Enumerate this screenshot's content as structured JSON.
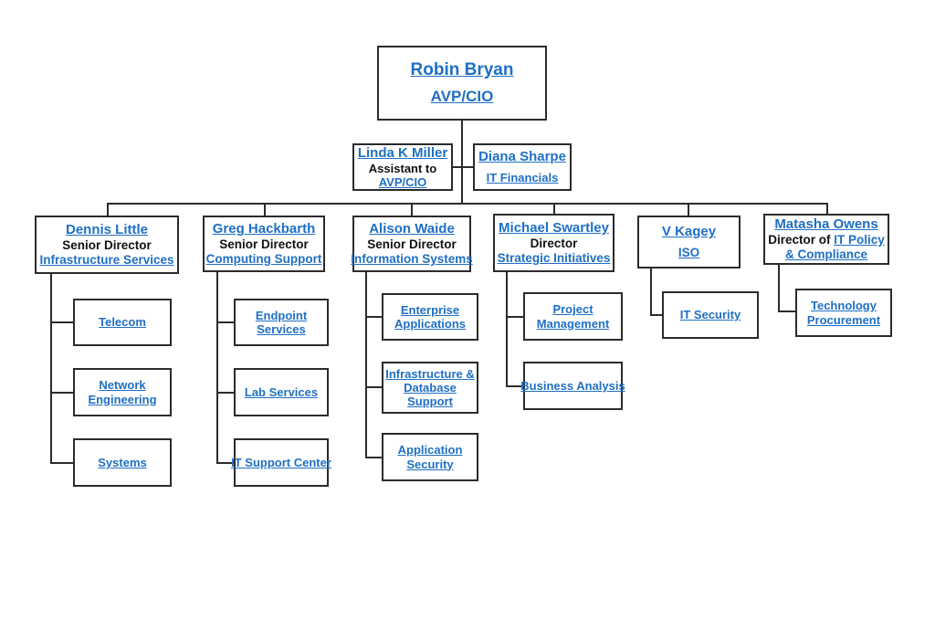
{
  "document": {
    "type": "organizational-chart",
    "background_color": "#ffffff",
    "link_color": "#1f6fc4",
    "text_color": "#111111",
    "border_color": "#2b2b2b"
  },
  "root": {
    "name": "Robin Bryan",
    "title": "AVP/CIO"
  },
  "staff": [
    {
      "name": "Linda K Miller",
      "role": "Assistant to",
      "unit": "AVP/CIO"
    },
    {
      "name": "Diana Sharpe",
      "role": "",
      "unit": " IT Financials"
    }
  ],
  "directors": [
    {
      "name": "Dennis Little",
      "role": "Senior Director",
      "unit": "Infrastructure Services",
      "children": [
        "Telecom",
        "Network Engineering",
        "Systems"
      ]
    },
    {
      "name": "Greg Hackbarth",
      "role": "Senior Director",
      "unit": "Computing Support",
      "children": [
        "Endpoint Services",
        "Lab Services",
        "IT Support Center"
      ]
    },
    {
      "name": "Alison Waide",
      "role": "Senior Director",
      "unit": "Information Systems",
      "children": [
        "Enterprise Applications",
        "Infrastructure & Database Support",
        "Application Security"
      ]
    },
    {
      "name": "Michael Swartley",
      "role": "Director",
      "unit": "Strategic Initiatives",
      "children": [
        "Project Management",
        "Business Analysis"
      ]
    },
    {
      "name": "V Kagey",
      "role": "",
      "unit": "ISO",
      "children": [
        "IT Security"
      ]
    },
    {
      "name": "Matasha Owens",
      "role_prefix": "Director of ",
      "role_link": "IT Policy & Compliance",
      "children": [
        "Technology Procurement"
      ]
    }
  ]
}
